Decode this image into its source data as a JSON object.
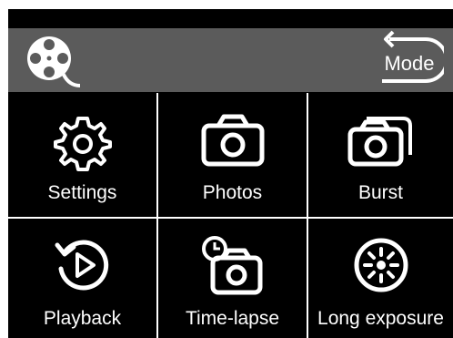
{
  "header": {
    "logo_icon": "film-reel-icon",
    "mode_button": {
      "label": "Mode",
      "icon": "return-arrow-icon"
    }
  },
  "tiles": [
    {
      "label": "Settings",
      "icon": "gear-icon"
    },
    {
      "label": "Photos",
      "icon": "camera-icon"
    },
    {
      "label": "Burst",
      "icon": "burst-camera-icon"
    },
    {
      "label": "Playback",
      "icon": "replay-icon"
    },
    {
      "label": "Time-lapse",
      "icon": "timer-camera-icon"
    },
    {
      "label": "Long exposure",
      "icon": "aperture-icon"
    }
  ],
  "colors": {
    "header_bg": "#5b5b5b",
    "tile_bg": "#000000",
    "divider": "#ffffff",
    "text": "#ffffff"
  }
}
